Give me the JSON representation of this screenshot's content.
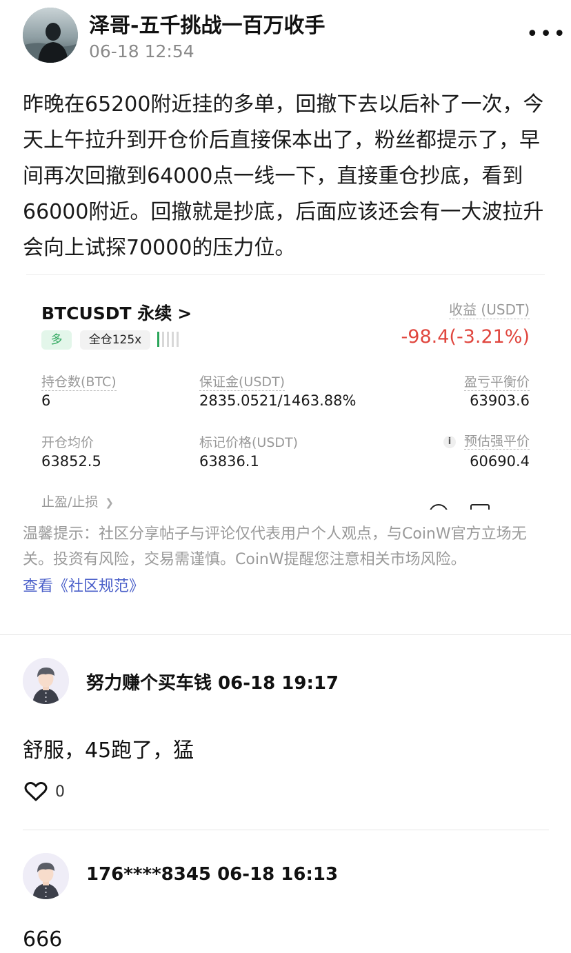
{
  "post": {
    "author": "泽哥-五千挑战一百万收手",
    "time": "06-18 12:54",
    "more": "•••",
    "body": "昨晚在65200附近挂的多单，回撤下去以后补了一次，今天上午拉升到开仓价后直接保本出了，粉丝都提示了，早间再次回撤到64000点一线一下，直接重仓抄底，看到66000附近。回撤就是抄底，后面应该还会有一大波拉升会向上试探70000的压力位。"
  },
  "position_card": {
    "symbol": "BTCUSDT 永续",
    "chevron": ">",
    "profit_label": "收益 (USDT)",
    "side": "多",
    "margin_mode": "全仓125x",
    "profit_value": "-98.4(-3.21%)",
    "fields": {
      "size_label": "持仓数(BTC)",
      "size_value": "6",
      "margin_label": "保证金(USDT)",
      "margin_value": "2835.0521/1463.88%",
      "breakeven_label": "盈亏平衡价",
      "breakeven_value": "63903.6",
      "entry_label": "开仓均价",
      "entry_value": "63852.5",
      "mark_label": "标记价格(USDT)",
      "mark_value": "63836.1",
      "liq_label": "预估强平价",
      "liq_value": "60690.4"
    },
    "tpsl_label": "止盈/止损",
    "info_icon": "i",
    "colors": {
      "loss": "#e0463e",
      "long": "#2aa55a"
    }
  },
  "disclaimer": {
    "text": "温馨提示：社区分享帖子与评论仅代表用户个人观点，与CoinW官方立场无关。投资有风险，交易需谨慎。CoinW提醒您注意相关市场风险。",
    "link": "查看《社区规范》"
  },
  "comments": [
    {
      "name": "努力赚个买车钱 06-18 19:17",
      "text": "舒服，45跑了，猛",
      "likes": "0"
    },
    {
      "name": "176****8345 06-18 16:13",
      "text": "666"
    }
  ]
}
